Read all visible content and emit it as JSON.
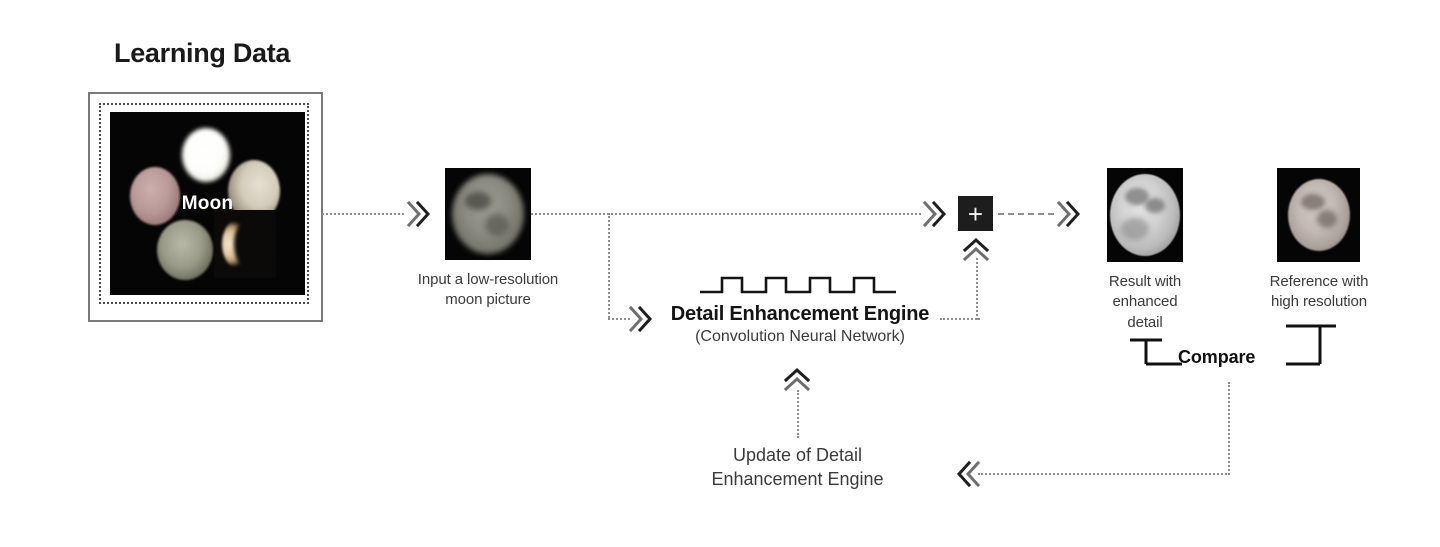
{
  "diagram": {
    "title": "Learning Data",
    "learning_data": {
      "image_label": "Moon",
      "image_alt": "grid of moon phase photographs"
    },
    "input": {
      "caption_line1": "Input a low-resolution",
      "caption_line2": "moon picture",
      "image_alt": "low-resolution moon photograph"
    },
    "engine": {
      "title": "Detail Enhancement Engine",
      "subtitle": "(Convolution Neural Network)",
      "waveform_pulses": 4
    },
    "combine": {
      "symbol": "+"
    },
    "result": {
      "caption_line1": "Result with",
      "caption_line2": "enhanced",
      "caption_line3": "detail",
      "image_alt": "enhanced-detail moon photograph"
    },
    "reference": {
      "caption_line1": "Reference with",
      "caption_line2": "high resolution",
      "image_alt": "high-resolution moon photograph"
    },
    "compare": {
      "label": "Compare"
    },
    "update": {
      "line1": "Update of Detail",
      "line2": "Enhancement Engine"
    },
    "colors": {
      "background": "#ffffff",
      "text_dark": "#1a1a1a",
      "text_body": "#3b3b3b",
      "connector": "#8e8e8e",
      "box_border": "#7a7a7a",
      "plus_box": "#1d1d1d",
      "photo_bg": "#050505"
    }
  }
}
